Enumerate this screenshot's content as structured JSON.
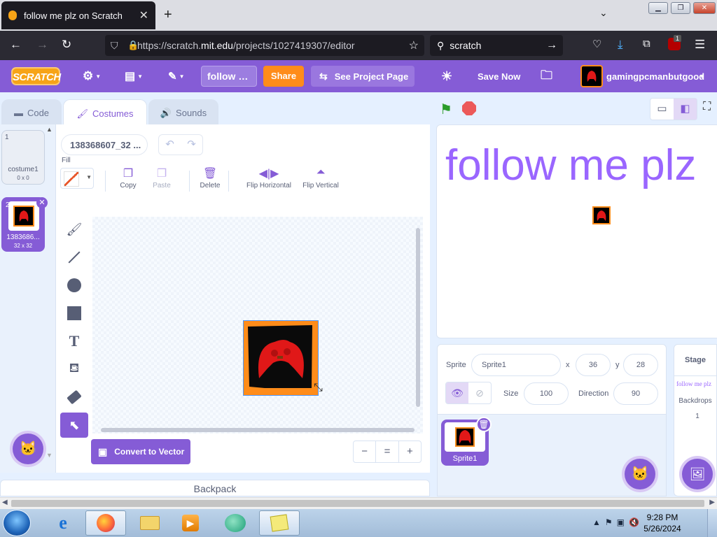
{
  "browser": {
    "tab_title": "follow me plz on Scratch",
    "tab_close": "✕",
    "new_tab": "+",
    "tab_list": "⌄",
    "url_prefix": "https://scratch.",
    "url_domain": "mit.edu",
    "url_path": "/projects/1027419307/editor",
    "search_value": "scratch",
    "extension_badge": "1"
  },
  "menu": {
    "logo": "SCRATCH",
    "project_title": "follow …",
    "share": "Share",
    "see_project_page": "See Project Page",
    "save_now": "Save Now",
    "username": "gamingpcmanbutgood"
  },
  "tabs": {
    "code": "Code",
    "costumes": "Costumes",
    "sounds": "Sounds"
  },
  "costumes": [
    {
      "number": "1",
      "name": "costume1",
      "size": "0 x 0"
    },
    {
      "number": "2",
      "name": "1383686...",
      "size": "32 x 32"
    }
  ],
  "paint_editor": {
    "costume_name": "138368607_32 ...",
    "fill_label": "Fill",
    "copy": "Copy",
    "paste": "Paste",
    "delete": "Delete",
    "flip_horizontal": "Flip Horizontal",
    "flip_vertical": "Flip Vertical",
    "convert_button": "Convert to Vector",
    "zoom_out": "−",
    "zoom_reset": "=",
    "zoom_in": "+"
  },
  "backpack": "Backpack",
  "stage": {
    "text": "follow me plz"
  },
  "sprite_info": {
    "sprite_label": "Sprite",
    "sprite_name": "Sprite1",
    "x_label": "x",
    "x_value": "36",
    "y_label": "y",
    "y_value": "28",
    "size_label": "Size",
    "size_value": "100",
    "direction_label": "Direction",
    "direction_value": "90"
  },
  "sprite_list": [
    {
      "name": "Sprite1"
    }
  ],
  "stage_panel": {
    "header": "Stage",
    "thumb_text": "follow me plz",
    "backdrops_label": "Backdrops",
    "backdrops_count": "1"
  },
  "taskbar": {
    "time": "9:28 PM",
    "date": "5/26/2024"
  },
  "colors": {
    "scratch_purple": "#855cd6",
    "share_orange": "#ff8c1a",
    "stage_text": "#9a66ff"
  }
}
